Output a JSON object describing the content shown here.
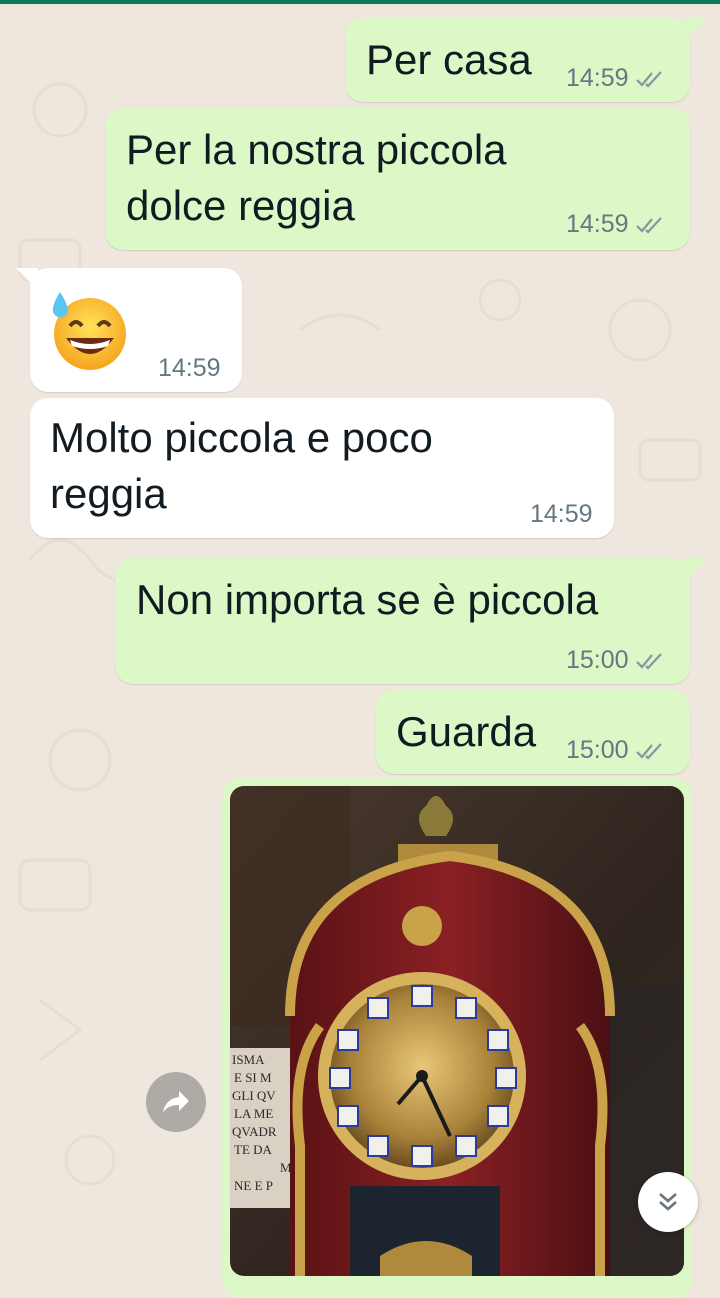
{
  "messages": [
    {
      "direction": "out",
      "text": "Per casa",
      "time": "14:59",
      "status": "read"
    },
    {
      "direction": "out",
      "text": "Per la nostra piccola\ndolce reggia",
      "time": "14:59",
      "status": "read"
    },
    {
      "direction": "in",
      "emoji": "😅",
      "time": "14:59"
    },
    {
      "direction": "in",
      "text": "Molto piccola e poco\nreggia",
      "time": "14:59"
    },
    {
      "direction": "out",
      "text": "Non importa se è piccola",
      "time": "15:00",
      "status": "read"
    },
    {
      "direction": "out",
      "text": "Guarda",
      "time": "15:00",
      "status": "read"
    }
  ],
  "colors": {
    "chat_background": "#efe7dd",
    "outgoing_bubble": "#dcf8c6",
    "incoming_bubble": "#ffffff",
    "header_accent": "#0b7a5a",
    "meta_text": "#667781"
  },
  "icons": {
    "read_receipt": "double-check-icon",
    "forward": "forward-arrow-icon",
    "scroll_down": "double-chevron-down-icon"
  },
  "image_message": {
    "subject": "photo-of-ornate-mantel-clock",
    "printed_text": "ISMA E SI M GLI QV LA ME QVADR TE DA M NE E P"
  }
}
